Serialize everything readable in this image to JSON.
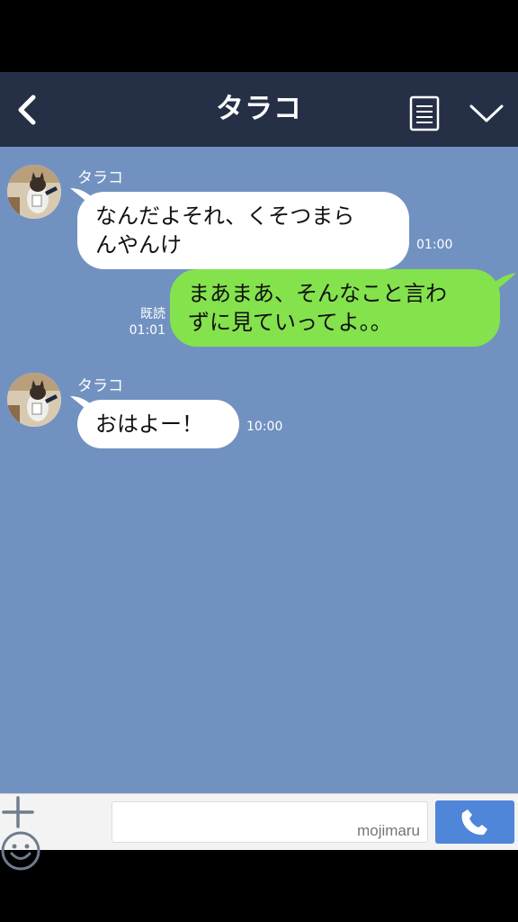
{
  "header": {
    "title": "タラコ"
  },
  "messages": [
    {
      "direction": "in",
      "sender": "タラコ",
      "lines": [
        "なんだよそれ、くそつまら",
        "んやんけ"
      ],
      "time": "01:00"
    },
    {
      "direction": "out",
      "lines": [
        "まあまあ、そんなこと言わ",
        "ずに見ていってよ。。"
      ],
      "read_label": "既読",
      "time": "01:01"
    },
    {
      "direction": "in",
      "sender": "タラコ",
      "lines": [
        "おはよー！"
      ],
      "time": "10:00"
    }
  ],
  "footer": {
    "input_placeholder": "mojimaru"
  },
  "colors": {
    "header_bg": "#253047",
    "chat_bg": "#7192c1",
    "outgoing_bubble": "#84e24d",
    "incoming_bubble": "#ffffff",
    "call_button": "#4f86d9"
  },
  "icons": {
    "back": "chevron-left-icon",
    "menu": "list-icon",
    "collapse": "chevron-down-icon",
    "add": "plus-icon",
    "emoji": "smiley-icon",
    "call": "phone-icon"
  }
}
